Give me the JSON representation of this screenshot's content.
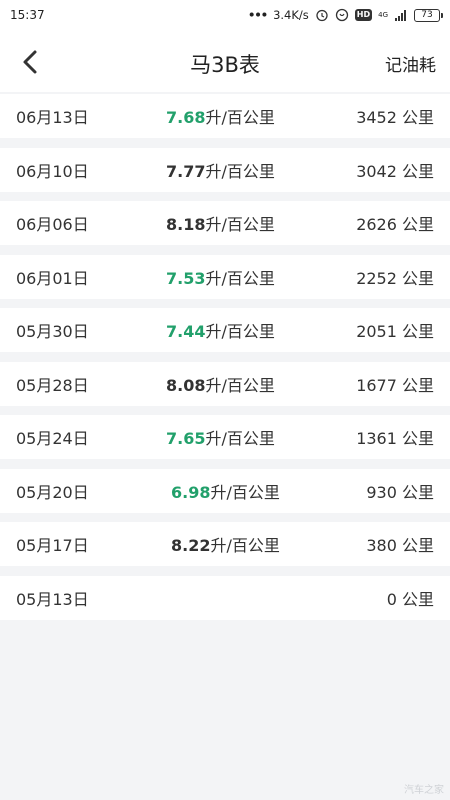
{
  "status_bar": {
    "time": "15:37",
    "speed": "3.4K/s",
    "network": "4G",
    "hd": "HD",
    "battery": "73"
  },
  "app_bar": {
    "title": "马3B表",
    "action": "记油耗"
  },
  "unit_label": "升/百公里",
  "distance_unit": "公里",
  "records": [
    {
      "date": "06月13日",
      "value": "7.68",
      "unit": "升/百公里",
      "distance": "3452 公里",
      "highlight": true
    },
    {
      "date": "06月10日",
      "value": "7.77",
      "unit": "升/百公里",
      "distance": "3042 公里",
      "highlight": false
    },
    {
      "date": "06月06日",
      "value": "8.18",
      "unit": "升/百公里",
      "distance": "2626 公里",
      "highlight": false
    },
    {
      "date": "06月01日",
      "value": "7.53",
      "unit": "升/百公里",
      "distance": "2252 公里",
      "highlight": true
    },
    {
      "date": "05月30日",
      "value": "7.44",
      "unit": "升/百公里",
      "distance": "2051 公里",
      "highlight": true
    },
    {
      "date": "05月28日",
      "value": "8.08",
      "unit": "升/百公里",
      "distance": "1677 公里",
      "highlight": false
    },
    {
      "date": "05月24日",
      "value": "7.65",
      "unit": "升/百公里",
      "distance": "1361 公里",
      "highlight": true
    },
    {
      "date": "05月20日",
      "value": "6.98",
      "unit": "升/百公里",
      "distance": "930 公里",
      "highlight": true
    },
    {
      "date": "05月17日",
      "value": "8.22",
      "unit": "升/百公里",
      "distance": "380 公里",
      "highlight": false
    },
    {
      "date": "05月13日",
      "value": "",
      "unit": "",
      "distance": "0 公里",
      "highlight": false
    }
  ],
  "colors": {
    "good": "#22a06b",
    "normal": "#333333",
    "background": "#f3f4f6"
  },
  "icons": {
    "back": "chevron-left-icon"
  },
  "watermark": "汽车之家"
}
